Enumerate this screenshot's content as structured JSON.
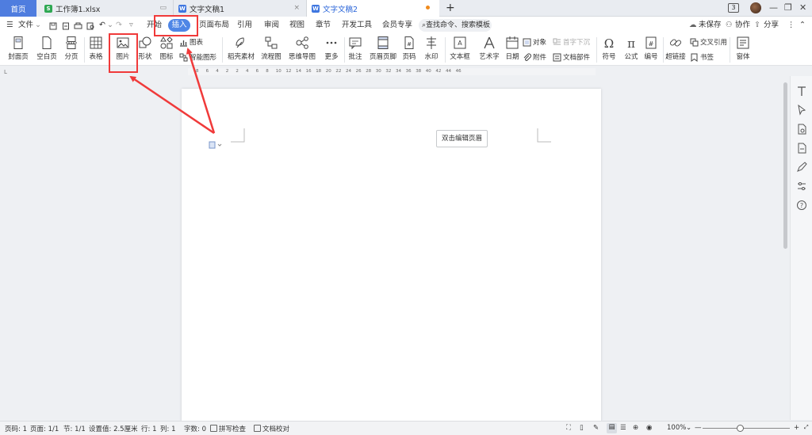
{
  "tabs": {
    "home": "首页",
    "xlsx": "工作簿1.xlsx",
    "doc1": "文字文稿1",
    "doc2": "文字文稿2",
    "badge_count": "3"
  },
  "menu": {
    "file": "文件",
    "items": [
      "开始",
      "插入",
      "页面布局",
      "引用",
      "审阅",
      "视图",
      "章节",
      "开发工具",
      "会员专享"
    ],
    "search_placeholder": "查找命令、搜索模板",
    "unsaved": "未保存",
    "collab": "协作",
    "share": "分享"
  },
  "ribbon": {
    "cover_page": "封面页",
    "blank_page": "空白页",
    "page_break": "分页",
    "table": "表格",
    "picture": "图片",
    "shape": "形状",
    "icon": "图标",
    "chart": "图表",
    "smart_art": "智能图形",
    "docer": "稻壳素材",
    "flowchart": "流程图",
    "mindmap": "思维导图",
    "more": "更多",
    "comment": "批注",
    "header_footer": "页眉页脚",
    "page_number": "页码",
    "watermark": "水印",
    "textbox": "文本框",
    "wordart": "艺术字",
    "date": "日期",
    "object": "对象",
    "attachment": "附件",
    "dropcap": "首字下沉",
    "doc_parts": "文档部件",
    "symbol": "符号",
    "formula": "公式",
    "numbering": "编号",
    "hyperlink": "超链接",
    "crossref": "交叉引用",
    "bookmark": "书签",
    "form": "窗体"
  },
  "ruler": {
    "ticks": [
      "8",
      "6",
      "4",
      "2",
      "2",
      "4",
      "6",
      "8",
      "10",
      "12",
      "14",
      "16",
      "18",
      "20",
      "22",
      "24",
      "26",
      "28",
      "30",
      "32",
      "34",
      "36",
      "38",
      "40",
      "42",
      "44",
      "46"
    ]
  },
  "page": {
    "header_hint": "双击编辑页眉"
  },
  "status": {
    "page_no": "页码: 1",
    "pages": "页面: 1/1",
    "section": "节: 1/1",
    "setting": "设置值: 2.5厘米",
    "row": "行: 1",
    "col": "列: 1",
    "words": "字数: 0",
    "spell": "拼写检查",
    "proofread": "文档校对",
    "zoom": "100%"
  },
  "colors": {
    "accent": "#4f86e6",
    "highlight_box": "#f03a3a",
    "home_tab": "#4f7ddf"
  }
}
